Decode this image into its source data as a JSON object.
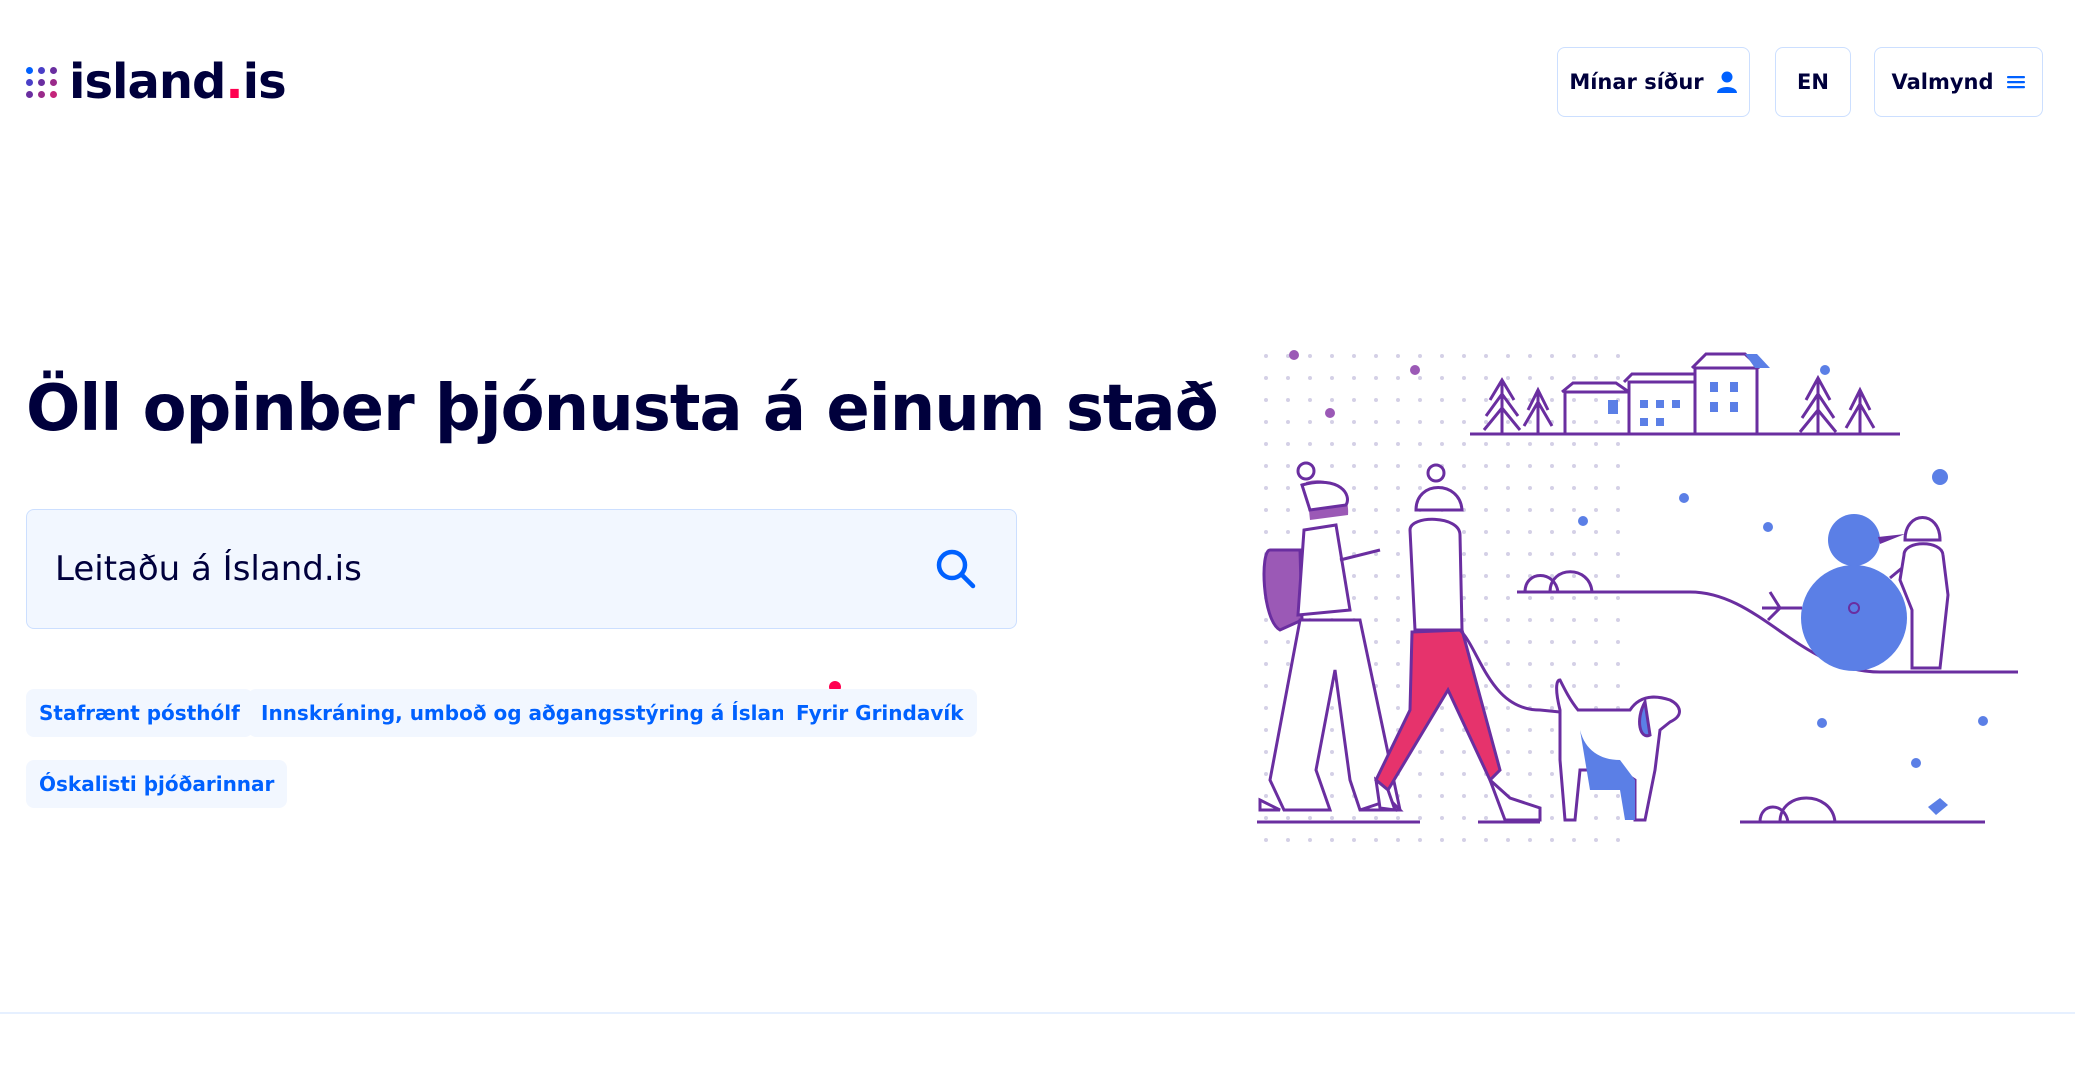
{
  "header": {
    "logo_text_main": "island",
    "logo_text_dot": ".",
    "logo_text_tail": "is",
    "my_pages_label": "Mínar síður",
    "language_label": "EN",
    "menu_label": "Valmynd",
    "user_icon": "user-icon",
    "menu_icon": "hamburger-icon"
  },
  "hero": {
    "title": "Öll opinber þjónusta á einum stað",
    "search": {
      "placeholder": "Leitaðu á Ísland.is",
      "icon": "search-icon"
    },
    "tags": [
      {
        "label": "Stafrænt pósthólf"
      },
      {
        "label": "Innskráning, umboð og aðgangsstýring á Ísland.is",
        "has_badge": true
      },
      {
        "label": "Fyrir Grindavík"
      },
      {
        "label": "Óskalisti þjóðarinnar"
      }
    ]
  },
  "colors": {
    "primary_dark": "#00003c",
    "blue": "#0061ff",
    "light_blue_bg": "#f2f7ff",
    "border_blue": "#ccdfff",
    "accent_red": "#ff0050",
    "purple": "#6a2ea0",
    "pink": "#e6336c",
    "illustration_blue": "#5b7fe6"
  }
}
